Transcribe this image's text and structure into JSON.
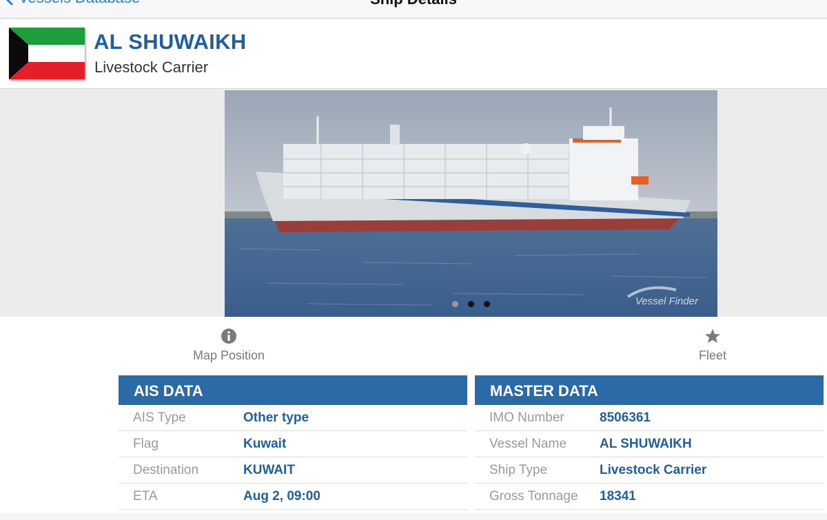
{
  "nav": {
    "back_label": "Vessels Database",
    "title": "Ship Details"
  },
  "header": {
    "name": "AL SHUWAIKH",
    "type": "Livestock Carrier",
    "flag_icon": "kuwait-flag"
  },
  "gallery": {
    "watermark": "Vessel Finder",
    "pages": 3,
    "active_page": 2
  },
  "actions": {
    "map_position": {
      "label": "Map Position",
      "icon": "info-circle-icon"
    },
    "fleet": {
      "label": "Fleet",
      "icon": "star-icon"
    }
  },
  "ais": {
    "title": "AIS DATA",
    "rows": [
      {
        "label": "AIS Type",
        "value": "Other type"
      },
      {
        "label": "Flag",
        "value": "Kuwait"
      },
      {
        "label": "Destination",
        "value": "KUWAIT"
      },
      {
        "label": "ETA",
        "value": "Aug 2, 09:00"
      }
    ]
  },
  "master": {
    "title": "MASTER DATA",
    "rows": [
      {
        "label": "IMO Number",
        "value": "8506361"
      },
      {
        "label": "Vessel Name",
        "value": "AL SHUWAIKH"
      },
      {
        "label": "Ship Type",
        "value": "Livestock Carrier"
      },
      {
        "label": "Gross Tonnage",
        "value": "18341"
      }
    ]
  },
  "colors": {
    "accent": "#2a6aa6",
    "value_text": "#1f5f9e",
    "link": "#1f7fe6"
  }
}
